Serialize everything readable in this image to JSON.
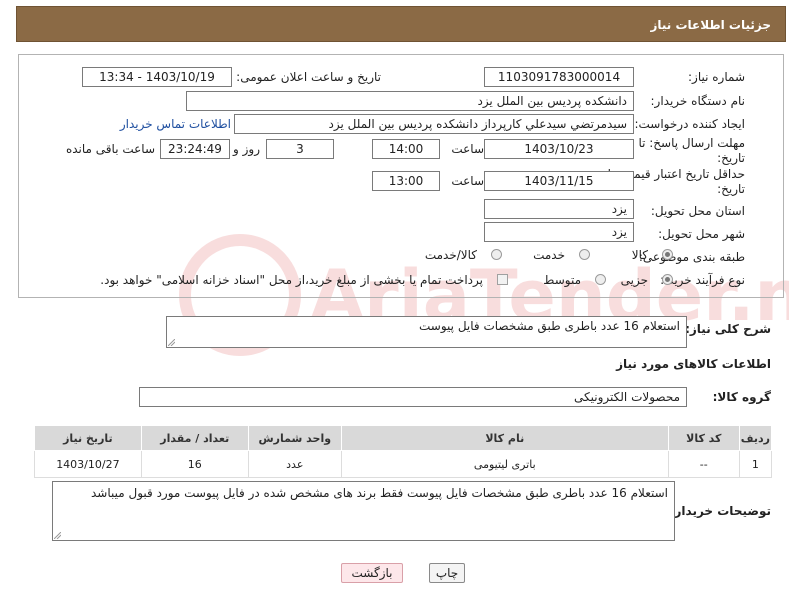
{
  "header": {
    "title": "جزئیات اطلاعات نیاز"
  },
  "form": {
    "need_number_label": "شماره نیاز:",
    "need_number": "1103091783000014",
    "announce_label": "تاریخ و ساعت اعلان عمومی:",
    "announce_value": "1403/10/19 - 13:34",
    "buyer_org_label": "نام دستگاه خریدار:",
    "buyer_org": "دانشکده پردیس بین الملل یزد",
    "creator_label": "ایجاد کننده درخواست:",
    "creator": "سیدمرتضي سيدعلي کارپرداز دانشکده پردیس بین الملل یزد",
    "contact_link": "اطلاعات تماس خریدار",
    "reply_deadline_label_1": "مهلت ارسال پاسخ: تا",
    "reply_deadline_label_2": "تاریخ:",
    "reply_date": "1403/10/23",
    "time_label": "ساعت",
    "reply_time": "14:00",
    "days_value": "3",
    "days_label": "روز و",
    "remaining_time": "23:24:49",
    "remaining_label": "ساعت باقی مانده",
    "price_deadline_label_1": "حداقل تاریخ اعتبار قیمت: تا",
    "price_deadline_label_2": "تاریخ:",
    "price_date": "1403/11/15",
    "price_time": "13:00",
    "province_label": "استان محل تحویل:",
    "province": "یزد",
    "city_label": "شهر محل تحویل:",
    "city": "یزد",
    "category_label": "طبقه بندی موضوعی:",
    "category_options": [
      "کالا",
      "خدمت",
      "کالا/خدمت"
    ],
    "process_label": "نوع فرآیند خرید :",
    "process_options": [
      "جزیی",
      "متوسط"
    ],
    "payment_note": "پرداخت تمام یا بخشی از مبلغ خرید،از محل \"اسناد خزانه اسلامی\" خواهد بود."
  },
  "description": {
    "label": "شرح کلی نیاز:",
    "value": "استعلام 16 عدد باطری طبق مشخصات فایل پیوست"
  },
  "goods": {
    "section_title": "اطلاعات کالاهای مورد نیاز",
    "group_label": "گروه کالا:",
    "group_value": "محصولات الکترونیکی",
    "columns": [
      "ردیف",
      "کد کالا",
      "نام کالا",
      "واحد شمارش",
      "تعداد / مقدار",
      "تاریخ نیاز"
    ],
    "rows": [
      {
        "row": "1",
        "code": "--",
        "name": "باتری لیتیومی",
        "unit": "عدد",
        "qty": "16",
        "date": "1403/10/27"
      }
    ]
  },
  "buyer_notes": {
    "label": "توضیحات خریدار:",
    "value": "استعلام 16 عدد باطری طبق مشخصات فایل پیوست فقط برند های مشخص شده در فایل پیوست مورد قبول میباشد"
  },
  "buttons": {
    "print": "چاپ",
    "back": "بازگشت"
  },
  "watermark": {
    "text": "AriaTender.net"
  },
  "colors": {
    "header_bg": "#8b6a45",
    "link": "#1f4fa0",
    "back_bg": "#fde7ea"
  }
}
